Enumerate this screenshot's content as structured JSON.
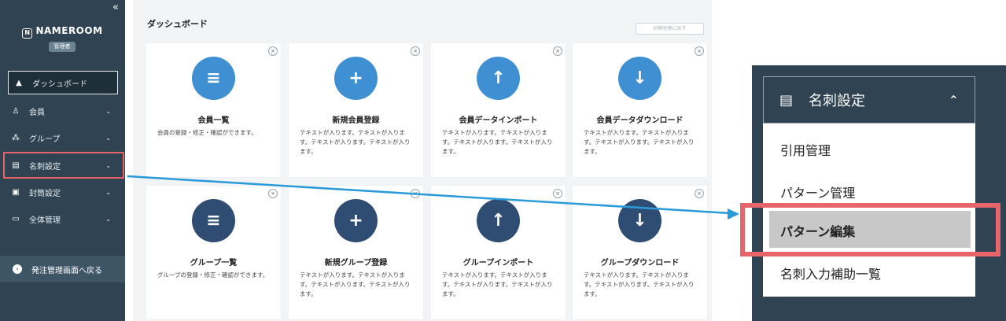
{
  "sidebar": {
    "collapse_icon": "«",
    "brand": "NAMEROOM",
    "brand_icon": "N",
    "role": "管理者",
    "items": [
      {
        "icon": "home-icon",
        "glyph": "▲",
        "label": "ダッシュボード",
        "chevron": ""
      },
      {
        "icon": "user-icon",
        "glyph": "♙",
        "label": "会員",
        "chevron": "⌄"
      },
      {
        "icon": "group-icon",
        "glyph": "⁂",
        "label": "グループ",
        "chevron": "⌄"
      },
      {
        "icon": "card-settings-icon",
        "glyph": "▤",
        "label": "名刺設定",
        "chevron": "⌄"
      },
      {
        "icon": "envelope-settings-icon",
        "glyph": "▣",
        "label": "封筒設定",
        "chevron": "⌄"
      },
      {
        "icon": "folder-settings-icon",
        "glyph": "▭",
        "label": "全体管理",
        "chevron": "⌄"
      }
    ],
    "back_label": "発注管理画面へ戻る",
    "back_icon": "›"
  },
  "main": {
    "title": "ダッシュボード",
    "restore_label": "初期状態に戻す",
    "cards": [
      {
        "title": "会員一覧",
        "desc": "会員の登録・修正・確認ができます。",
        "icon": "member-list-icon",
        "glyph": "≡",
        "color": "#3f8fd3"
      },
      {
        "title": "新規会員登録",
        "desc": "テキストが入ります。テキストが入ります。テキストが入ります。テキストが入ります。",
        "icon": "add-member-icon",
        "glyph": "+",
        "color": "#3f8fd3"
      },
      {
        "title": "会員データインポート",
        "desc": "テキストが入ります。テキストが入ります。テキストが入ります。テキストが入ります。",
        "icon": "member-import-icon",
        "glyph": "↑",
        "color": "#3f8fd3"
      },
      {
        "title": "会員データダウンロード",
        "desc": "テキストが入ります。テキストが入ります。テキストが入ります。テキストが入ります。",
        "icon": "member-download-icon",
        "glyph": "↓",
        "color": "#3f8fd3"
      },
      {
        "title": "グループ一覧",
        "desc": "グループの登録・修正・確認ができます。",
        "icon": "group-list-icon",
        "glyph": "≡",
        "color": "#2f4d73"
      },
      {
        "title": "新規グループ登録",
        "desc": "テキストが入ります。テキストが入ります。テキストが入ります。テキストが入ります。",
        "icon": "add-group-icon",
        "glyph": "+",
        "color": "#2f4d73"
      },
      {
        "title": "グループインポート",
        "desc": "テキストが入ります。テキストが入ります。テキストが入ります。テキストが入ります。",
        "icon": "group-import-icon",
        "glyph": "↑",
        "color": "#2f4d73"
      },
      {
        "title": "グループダウンロード",
        "desc": "テキストが入ります。テキストが入ります。テキストが入ります。テキストが入ります。",
        "icon": "group-download-icon",
        "glyph": "↓",
        "color": "#2f4d73"
      }
    ]
  },
  "zoom": {
    "header": "名刺設定",
    "header_icon": "▤",
    "header_chevron": "⌃",
    "items": [
      "引用管理",
      "パターン管理",
      "パターン編集",
      "名刺入力補助一覧"
    ]
  },
  "colors": {
    "sidebar_bg": "#2f4352",
    "highlight": "#e8646b",
    "arrow": "#2a9ad8"
  }
}
